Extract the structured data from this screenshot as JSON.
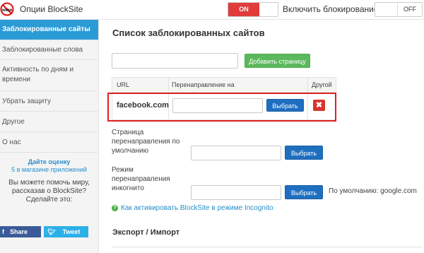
{
  "header": {
    "title": "Опции BlockSite",
    "toggle_on_label": "ON",
    "toggle_label": "Включить блокирование",
    "toggle_off_label": "OFF"
  },
  "sidebar": {
    "items": [
      {
        "label": "Заблокированные сайты"
      },
      {
        "label": "Заблокированные слова"
      },
      {
        "label": "Активность по дням и времени"
      },
      {
        "label": "Убрать защиту"
      },
      {
        "label": "Другое"
      },
      {
        "label": "О нас"
      }
    ],
    "rate_line1": "Дайте оценку",
    "rate_line2": "5 в магазине приложений",
    "help_text": "Вы можете помочь миру, рассказав о BlockSite? Сделайте это:",
    "share_label": "Share",
    "tweet_label": "Tweet"
  },
  "main": {
    "title": "Список заблокированных сайтов",
    "add_input_value": "",
    "add_button": "Добавить страницу",
    "table": {
      "columns": [
        "URL",
        "Перенаправление на",
        "Другой"
      ],
      "rows": [
        {
          "url": "facebook.com",
          "redirect": "",
          "choose_label": "Выбрать"
        }
      ]
    },
    "default_redirect_label": "Страница перенаправления по умолчанию",
    "default_redirect_button": "Выбрать",
    "incognito_label": "Режим перенаправления инкогнито",
    "incognito_button": "Выбрать",
    "incognito_default_hint": "По умолчанию: google.com",
    "incognito_help_link": "Как активировать BlockSite в режиме Incognito",
    "export_section_title": "Экспорт / Импорт"
  },
  "colors": {
    "accent": "#2b9bd6",
    "toggle_on": "#e03c3c",
    "add_button": "#5cb85c",
    "choose_button": "#1f6fc0",
    "delete_button": "#d9342b",
    "highlight_frame": "#e02020",
    "share_button": "#3b5b98",
    "tweet_button": "#2cb0e8"
  },
  "icons": [
    "blocksite-logo-icon",
    "facebook-icon",
    "twitter-icon",
    "delete-icon",
    "help-icon"
  ]
}
